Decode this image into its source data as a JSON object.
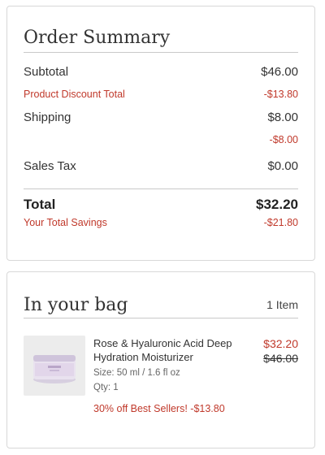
{
  "summary": {
    "title": "Order Summary",
    "subtotal": {
      "label": "Subtotal",
      "value": "$46.00"
    },
    "discount": {
      "label": "Product Discount Total",
      "value": "-$13.80"
    },
    "shipping": {
      "label": "Shipping",
      "value": "$8.00"
    },
    "shipping_discount": {
      "value": "-$8.00"
    },
    "tax": {
      "label": "Sales Tax",
      "value": "$0.00"
    },
    "total": {
      "label": "Total",
      "value": "$32.20"
    },
    "savings": {
      "label": "Your Total Savings",
      "value": "-$21.80"
    }
  },
  "bag": {
    "title": "In your bag",
    "item_count": "1 Item",
    "items": [
      {
        "name": "Rose & Hyaluronic Acid Deep Hydration Moisturizer",
        "size": "Size: 50 ml / 1.6 fl oz",
        "qty": "Qty: 1",
        "price": "$32.20",
        "original_price": "$46.00",
        "promo": "30% off Best Sellers! -$13.80"
      }
    ]
  },
  "colors": {
    "discount_red": "#c0392b",
    "border": "#d8d8d8"
  }
}
